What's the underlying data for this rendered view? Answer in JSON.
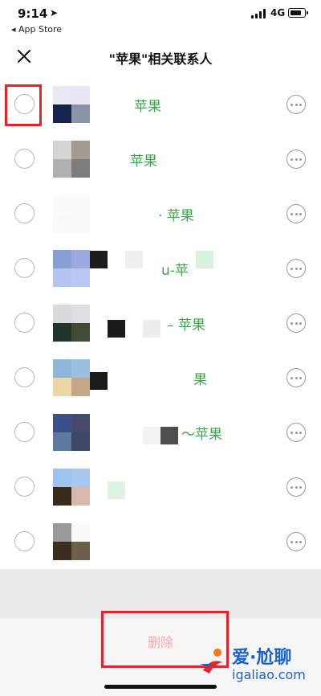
{
  "status_bar": {
    "time": "9:14",
    "back_app": "◂ App Store",
    "network": "4G"
  },
  "nav": {
    "title": "\"苹果\"相关联系人",
    "close_icon": "close-icon"
  },
  "contacts": [
    {
      "name": "苹果",
      "selected_highlight": true
    },
    {
      "name": "苹果"
    },
    {
      "name": "· 苹果"
    },
    {
      "name": "u-苹"
    },
    {
      "name": "– 苹果"
    },
    {
      "name": "果"
    },
    {
      "name": "～苹果"
    },
    {
      "name": ""
    },
    {
      "name": ""
    }
  ],
  "footer": {
    "delete_label": "删除"
  },
  "watermark": {
    "line1": "爱·尬聊",
    "line2": "igaliao.com"
  },
  "colors": {
    "name_green": "#3aa64a",
    "highlight_red": "#e3242b",
    "delete_disabled": "#f2a9a9",
    "watermark_blue": "#1a62c9"
  }
}
